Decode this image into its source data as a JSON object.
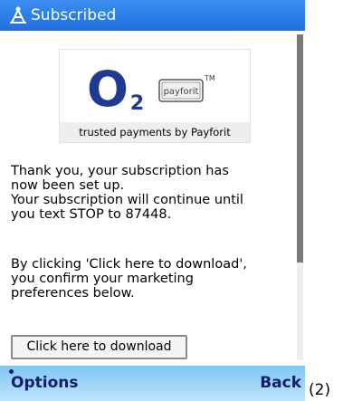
{
  "title_bar": {
    "title": "Subscribed",
    "icon": "subscription-icon"
  },
  "logo_box": {
    "o2_logo": "O2",
    "payforit_logo": "payforit",
    "trademark": "TM",
    "caption": "trusted payments by Payforit"
  },
  "message": {
    "lines": [
      "Thank you, your subscription has",
      "now been set up.",
      "Your subscription will continue until",
      "you text STOP to 87448."
    ]
  },
  "consent": {
    "lines": [
      "By clicking 'Click here to download',",
      "you confirm your marketing",
      "preferences below."
    ]
  },
  "download_button": {
    "label": "Click here to download"
  },
  "softkeys": {
    "left": "Options",
    "right": "Back"
  },
  "annotation": "(2)",
  "colors": {
    "title_bar": "#2a7de8",
    "softkey_bar": "#9fd4f7",
    "softkey_text": "#0d1f6a",
    "o2_blue": "#1f3a93"
  }
}
